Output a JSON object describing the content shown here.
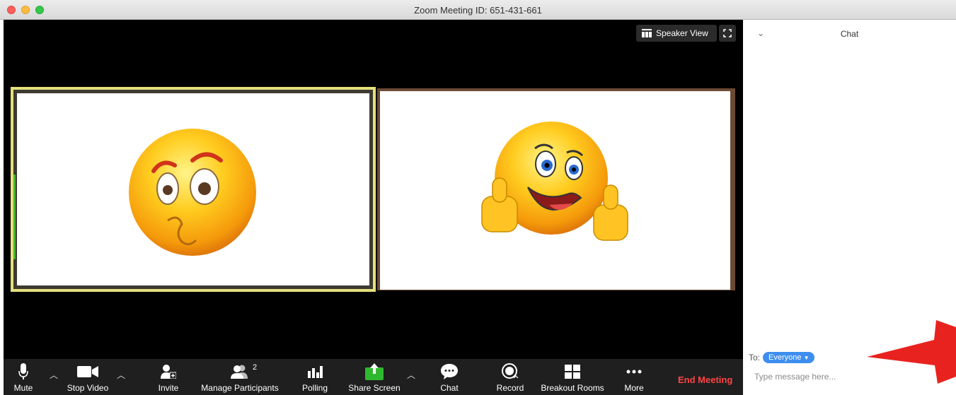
{
  "window": {
    "title": "Zoom Meeting ID: 651-431-661"
  },
  "video": {
    "speaker_view_label": "Speaker View"
  },
  "toolbar": {
    "mute_label": "Mute",
    "stop_video_label": "Stop Video",
    "invite_label": "Invite",
    "manage_participants_label": "Manage Participants",
    "participants_count": "2",
    "polling_label": "Polling",
    "share_screen_label": "Share Screen",
    "chat_label": "Chat",
    "record_label": "Record",
    "breakout_rooms_label": "Breakout Rooms",
    "more_label": "More",
    "end_meeting_label": "End Meeting"
  },
  "chat": {
    "title": "Chat",
    "to_label": "To:",
    "recipient": "Everyone",
    "placeholder": "Type message here..."
  },
  "icons": {
    "traffic_close": "close-dot",
    "traffic_min": "minimize-dot",
    "traffic_max": "maximize-dot",
    "mute": "microphone-icon",
    "video": "video-camera-icon",
    "invite": "add-user-icon",
    "participants": "participants-icon",
    "polling": "bar-chart-icon",
    "share": "share-screen-icon",
    "chat": "chat-bubble-icon",
    "record": "record-icon",
    "breakout": "grid-icon",
    "more": "ellipsis-icon",
    "annotation": "red-arrow"
  },
  "colors": {
    "toolbar_bg": "#1f1f1f",
    "active_speaker_border": "#e5e07c",
    "share_green": "#2fb82f",
    "end_meeting": "#ff4444",
    "recipient_pill": "#3d8ef0",
    "arrow": "#e8231f"
  }
}
